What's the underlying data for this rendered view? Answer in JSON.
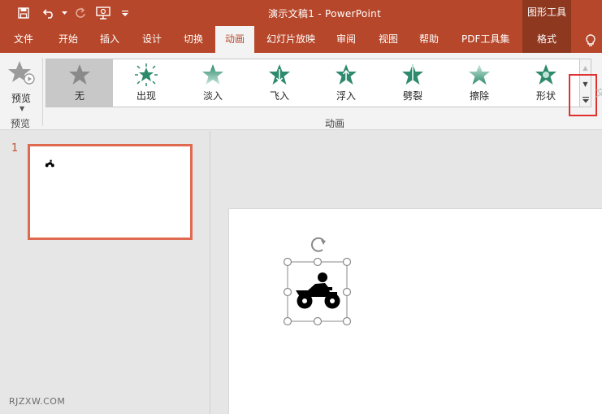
{
  "titlebar": {
    "document_title": "演示文稿1  -  PowerPoint",
    "contextual_title": "图形工具"
  },
  "tabs": [
    {
      "label": "文件"
    },
    {
      "label": "开始"
    },
    {
      "label": "插入"
    },
    {
      "label": "设计"
    },
    {
      "label": "切换"
    },
    {
      "label": "动画",
      "active": true
    },
    {
      "label": "幻灯片放映"
    },
    {
      "label": "审阅"
    },
    {
      "label": "视图"
    },
    {
      "label": "帮助"
    },
    {
      "label": "PDF工具集"
    },
    {
      "label": "格式",
      "contextual": true
    }
  ],
  "ribbon": {
    "preview": {
      "label": "预览",
      "group_label": "预览"
    },
    "animation_group_label": "动画",
    "animations": [
      {
        "label": "无",
        "selected": true,
        "icon": "star-gray-icon"
      },
      {
        "label": "出现",
        "icon": "star-burst-icon"
      },
      {
        "label": "淡入",
        "icon": "star-fade-icon"
      },
      {
        "label": "飞入",
        "icon": "star-fly-icon"
      },
      {
        "label": "浮入",
        "icon": "star-float-icon"
      },
      {
        "label": "劈裂",
        "icon": "star-split-icon"
      },
      {
        "label": "擦除",
        "icon": "star-wipe-icon"
      },
      {
        "label": "形状",
        "icon": "star-shape-icon"
      }
    ],
    "faded_text": "文"
  },
  "slides": [
    {
      "number": "1"
    }
  ],
  "watermark": "RJZXW.COM",
  "colors": {
    "accent": "#b7472a",
    "contextual": "#8f3820",
    "star_green": "#2e8a6c",
    "highlight": "#e03030"
  }
}
